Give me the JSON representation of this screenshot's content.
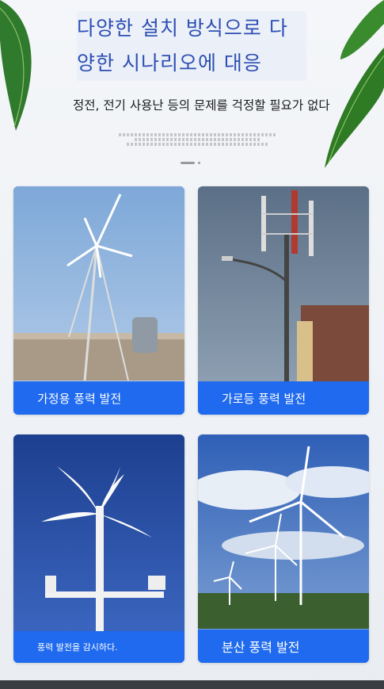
{
  "header": {
    "title_line1": "다양한 설치 방식으로 다",
    "title_line2": "양한 시나리오에 대응",
    "subtitle": "정전, 전기 사용난 등의 문제를 걱정할 필요가 없다"
  },
  "cards": [
    {
      "label": "가정용 풍력 발전"
    },
    {
      "label": "가로등 풍력 발전"
    },
    {
      "label": "풍력 발전을 감시하다."
    },
    {
      "label": "분산 풍력 발전"
    }
  ],
  "colors": {
    "title": "#2d4fb3",
    "label_bg": "#1f6aee"
  }
}
